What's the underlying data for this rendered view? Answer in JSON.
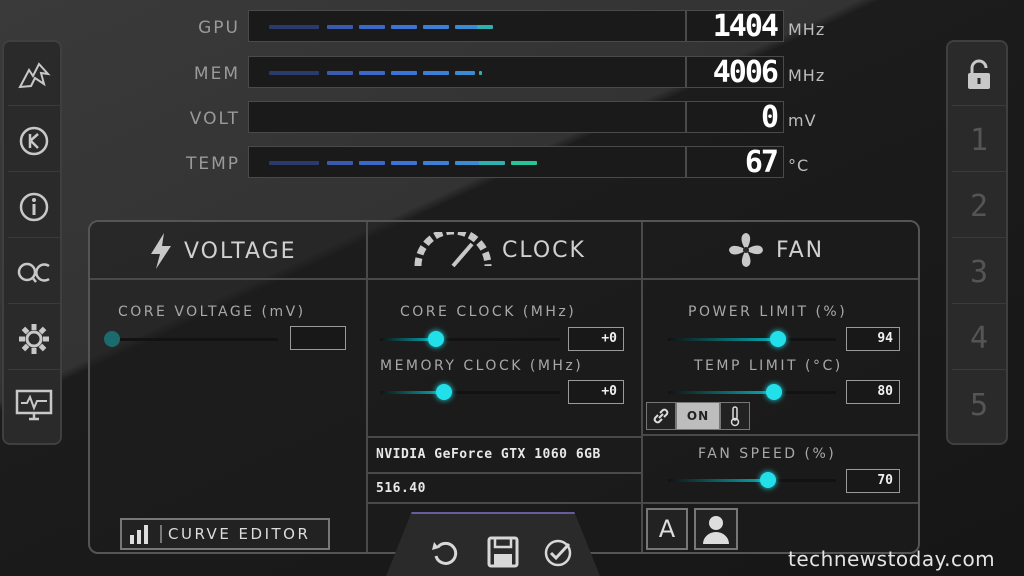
{
  "readouts": [
    {
      "label": "GPU",
      "value": "1404",
      "unit": "MHz"
    },
    {
      "label": "MEM",
      "value": "4006",
      "unit": "MHz"
    },
    {
      "label": "VOLT",
      "value": "0",
      "unit": "mV"
    },
    {
      "label": "TEMP",
      "value": "67",
      "unit": "°C"
    }
  ],
  "sidebar_left": {
    "icons": [
      "msi-dragon-icon",
      "kombustor-icon",
      "info-icon",
      "oc-scanner-icon",
      "settings-gear-icon",
      "monitor-icon"
    ]
  },
  "sidebar_right": {
    "lock_icon": "unlock-icon",
    "profiles": [
      "1",
      "2",
      "3",
      "4",
      "5"
    ]
  },
  "voltage": {
    "title": "VOLTAGE",
    "core_voltage_label": "CORE VOLTAGE  (mV)",
    "core_voltage_value": "",
    "curve_editor_label": "CURVE EDITOR"
  },
  "clock": {
    "title": "CLOCK",
    "core_clock_label": "CORE CLOCK (MHz)",
    "core_clock_value": "+0",
    "memory_clock_label": "MEMORY CLOCK (MHz)",
    "memory_clock_value": "+0",
    "gpu_name": "NVIDIA GeForce GTX 1060 6GB",
    "driver_version": "516.40"
  },
  "fan": {
    "title": "FAN",
    "power_limit_label": "POWER LIMIT (%)",
    "power_limit_value": "94",
    "temp_limit_label": "TEMP LIMIT (°C)",
    "temp_limit_value": "80",
    "link_toggle": "ON",
    "fan_speed_label": "FAN SPEED (%)",
    "fan_speed_value": "70",
    "auto_label": "A"
  },
  "colors": {
    "accent_cyan": "#22e0ea",
    "bar_blue": "#3a78d8",
    "bar_teal": "#27c49a"
  },
  "watermark": "technewstoday.com"
}
